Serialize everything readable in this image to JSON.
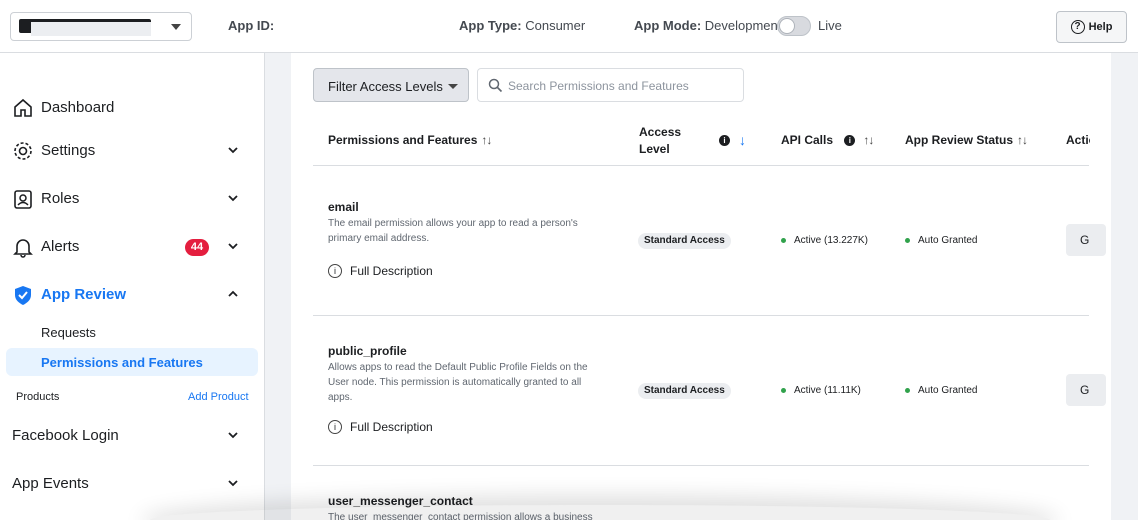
{
  "topbar": {
    "app_id_label": "App ID:",
    "app_type_label": "App Type:",
    "app_type_value": "Consumer",
    "app_mode_label": "App Mode:",
    "app_mode_value": "Development",
    "live_label": "Live",
    "help_label": "Help"
  },
  "sidebar": {
    "dashboard": "Dashboard",
    "settings": "Settings",
    "roles": "Roles",
    "alerts": "Alerts",
    "alerts_count": "44",
    "app_review": "App Review",
    "requests": "Requests",
    "permissions": "Permissions and Features",
    "products": "Products",
    "add_product": "Add Product",
    "facebook_login": "Facebook Login",
    "app_events": "App Events"
  },
  "toolbar": {
    "filter_label": "Filter Access Levels",
    "search_placeholder": "Search Permissions and Features"
  },
  "table": {
    "headers": {
      "permissions": "Permissions and Features",
      "access_level_1": "Access",
      "access_level_2": "Level",
      "api_calls": "API Calls",
      "review_status": "App Review Status",
      "actions": "Actions"
    },
    "full_description_label": "Full Description",
    "rows": [
      {
        "name": "email",
        "desc": "The email permission allows your app to read a person's primary email address.",
        "access": "Standard Access",
        "api": "Active (13.227K)",
        "review": "Auto Granted",
        "action": "G"
      },
      {
        "name": "public_profile",
        "desc": "Allows apps to read the Default Public Profile Fields on the User node. This permission is automatically granted to all apps.",
        "access": "Standard Access",
        "api": "Active (11.11K)",
        "review": "Auto Granted",
        "action": "G"
      },
      {
        "name": "user_messenger_contact",
        "desc": "The user_messenger_contact permission allows a business"
      }
    ]
  },
  "colors": {
    "accent": "#1877f2",
    "badge": "#e41e3f",
    "status_green": "#31a24c"
  }
}
